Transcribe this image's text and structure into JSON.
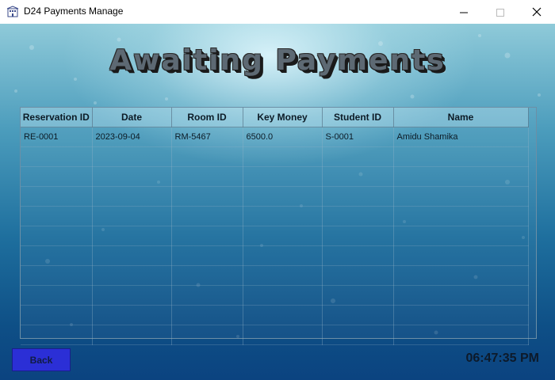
{
  "window": {
    "title": "D24 Payments Manage",
    "icons": {
      "app": "building-icon",
      "minimize": "minimize-icon",
      "maximize": "maximize-icon",
      "close": "close-icon"
    }
  },
  "page": {
    "heading": "Awaiting Payments"
  },
  "table": {
    "columns": [
      "Reservation ID",
      "Date",
      "Room ID",
      "Key Money",
      "Student ID",
      "Name"
    ],
    "rows": [
      [
        "RE-0001",
        "2023-09-04",
        "RM-5467",
        "6500.0",
        "S-0001",
        "Amidu Shamika"
      ]
    ],
    "empty_rows": 10
  },
  "footer": {
    "back_label": "Back",
    "clock": "06:47:35 PM"
  },
  "colors": {
    "accent_button": "#2b2fd6",
    "background_top": "#8fcad9",
    "background_bottom": "#0b4380"
  }
}
